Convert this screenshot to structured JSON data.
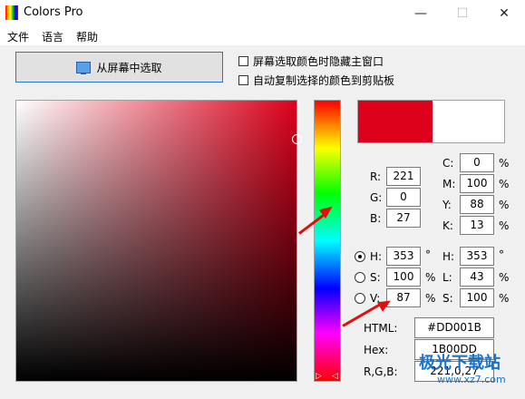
{
  "window": {
    "title": "Colors Pro",
    "minimize": "—",
    "maximize": "☐",
    "close": "✕"
  },
  "menu": [
    "文件",
    "语言",
    "帮助"
  ],
  "pick_button": "从屏幕中选取",
  "options": {
    "hide_main": "屏幕选取颜色时隐藏主窗口",
    "auto_copy": "自动复制选择的颜色到剪贴板"
  },
  "color_hex": "#dd001b",
  "rgb": {
    "r_label": "R:",
    "g_label": "G:",
    "b_label": "B:",
    "r": "221",
    "g": "0",
    "b": "27"
  },
  "cmyk": {
    "c_label": "C:",
    "m_label": "M:",
    "y_label": "Y:",
    "k_label": "K:",
    "c": "0",
    "m": "100",
    "y": "88",
    "k": "13",
    "unit": "%"
  },
  "hsv": {
    "h_label": "H:",
    "s_label": "S:",
    "v_label": "V:",
    "h": "353",
    "s": "100",
    "v": "87",
    "h_unit": "°",
    "unit": "%"
  },
  "hsl": {
    "h_label": "H:",
    "l_label": "L:",
    "s_label": "S:",
    "h": "353",
    "l": "43",
    "s": "100",
    "h_unit": "°",
    "unit": "%"
  },
  "formats": {
    "html_label": "HTML:",
    "html": "#DD001B",
    "hex_label": "Hex:",
    "hex": "1B00DD",
    "rgb_label": "R,G,B:",
    "rgb": "221,0,27"
  },
  "watermark": {
    "text": "极光下载站",
    "url": "www.xz7.com"
  }
}
